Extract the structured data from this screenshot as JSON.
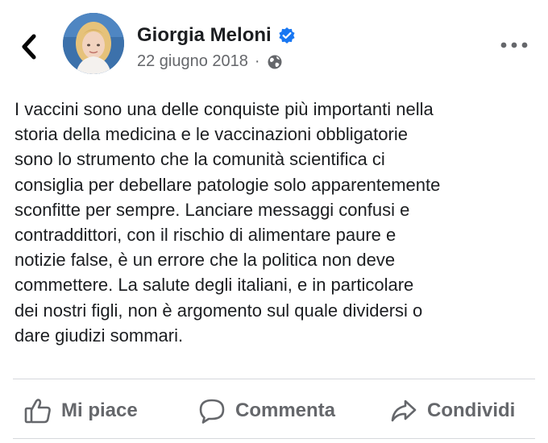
{
  "post": {
    "author_name": "Giorgia Meloni",
    "date": "22 giugno 2018",
    "separator": "·",
    "text": "I vaccini sono una delle conquiste più importanti nella\nstoria della medicina e le vaccinazioni obbligatorie\nsono lo strumento che la comunità scientifica ci\nconsiglia per debellare patologie solo apparentemente\nsconfitte per sempre. Lanciare messaggi confusi e\ncontraddittori, con il rischio di alimentare paure e\nnotizie false, è un errore che la politica non deve\ncommettere. La salute degli italiani, e in particolare\ndei nostri figli, non è argomento sul quale dividersi o\ndare giudizi sommari."
  },
  "icons": {
    "back": "chevron-left-icon",
    "verified": "verified-badge-icon",
    "privacy": "globe-icon",
    "more": "more-dots-icon",
    "like": "thumbs-up-icon",
    "comment": "comment-bubble-icon",
    "share": "share-arrow-icon"
  },
  "actions": {
    "like_label": "Mi piace",
    "comment_label": "Commenta",
    "share_label": "Condividi"
  },
  "colors": {
    "verified_blue": "#1877f2",
    "secondary_text": "#65676b",
    "primary_text": "#1c1e21"
  }
}
